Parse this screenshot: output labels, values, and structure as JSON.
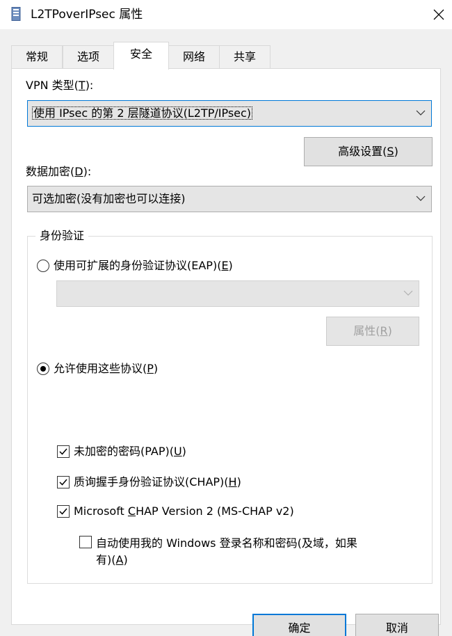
{
  "window": {
    "title": "L2TPoverIPsec 属性",
    "icon": "phone-book-icon",
    "close_glyph": "✕"
  },
  "tabs": [
    {
      "label": "常规",
      "active": false
    },
    {
      "label": "选项",
      "active": false
    },
    {
      "label": "安全",
      "active": true
    },
    {
      "label": "网络",
      "active": false
    },
    {
      "label": "共享",
      "active": false
    }
  ],
  "vpn_type": {
    "label": "VPN 类型(",
    "label_key": "T",
    "label_end": "):",
    "selected": "使用 IPsec 的第 2 层隧道协议(L2TP/IPsec)"
  },
  "advanced_button": {
    "label": "高级设置(",
    "key": "S",
    "end": ")"
  },
  "encryption": {
    "label": "数据加密(",
    "label_key": "D",
    "label_end": "):",
    "selected": "可选加密(没有加密也可以连接)"
  },
  "authentication": {
    "group_label": "身份验证",
    "eap_radio": {
      "label": "使用可扩展的身份验证协议(EAP)(",
      "key": "E",
      "end": ")",
      "checked": false
    },
    "eap_select": {
      "selected": "",
      "disabled": true
    },
    "properties_button": {
      "label": "属性(",
      "key": "R",
      "end": ")",
      "disabled": true
    },
    "protocols_radio": {
      "label": "允许使用这些协议(",
      "key": "P",
      "end": ")",
      "checked": true
    },
    "checkboxes": [
      {
        "label": "未加密的密码(PAP)(",
        "key": "U",
        "end": ")",
        "checked": true
      },
      {
        "label": "质询握手身份验证协议(CHAP)(",
        "key": "H",
        "end": ")",
        "checked": true
      },
      {
        "label_before": "Microsoft ",
        "key": "C",
        "label_after": "HAP Version 2 (MS-CHAP v2)",
        "checked": true
      }
    ],
    "auto_windows_logon": {
      "line1": "自动使用我的 Windows 登录名称和密码(及域，如果",
      "line2_before": "有)(",
      "key": "A",
      "line2_end": ")",
      "checked": false
    }
  },
  "footer": {
    "ok_label": "确定",
    "cancel_label": "取消"
  },
  "colors": {
    "accent": "#0078d7",
    "dialog_bg": "#f0f0f0",
    "panel_bg": "#ffffff",
    "disabled_text": "#a0a0a0"
  }
}
